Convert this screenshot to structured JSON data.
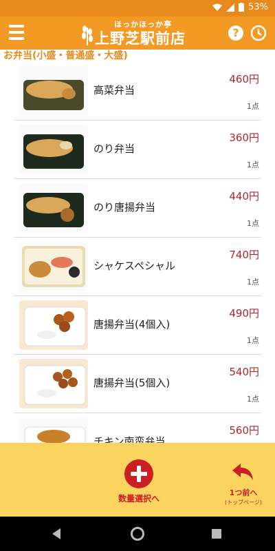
{
  "status_bar": {
    "battery": "53%"
  },
  "header": {
    "logo_sub": "ほっかほっか亭",
    "logo_main": "上野芝駅前店",
    "help_label": "?"
  },
  "category": {
    "title": "お弁当(小盛・普通盛・大盛)"
  },
  "items": [
    {
      "name": "高菜弁当",
      "price": "460円",
      "qty": "1点"
    },
    {
      "name": "のり弁当",
      "price": "360円",
      "qty": "1点"
    },
    {
      "name": "のり唐揚弁当",
      "price": "440円",
      "qty": "1点"
    },
    {
      "name": "シャケスペシャル",
      "price": "740円",
      "qty": "1点"
    },
    {
      "name": "唐揚弁当(4個入)",
      "price": "490円",
      "qty": "1点"
    },
    {
      "name": "唐揚弁当(5個入)",
      "price": "540円",
      "qty": "1点"
    },
    {
      "name": "チキン南蛮弁当",
      "price": "560円",
      "qty": ""
    }
  ],
  "footer": {
    "quantity_label": "数量選択へ",
    "back_label": "1つ前へ",
    "back_sub": "(トップページ)"
  },
  "colors": {
    "header": "#f39a24",
    "accent_red": "#cc1f24",
    "footer_bg": "#fbd35f"
  }
}
